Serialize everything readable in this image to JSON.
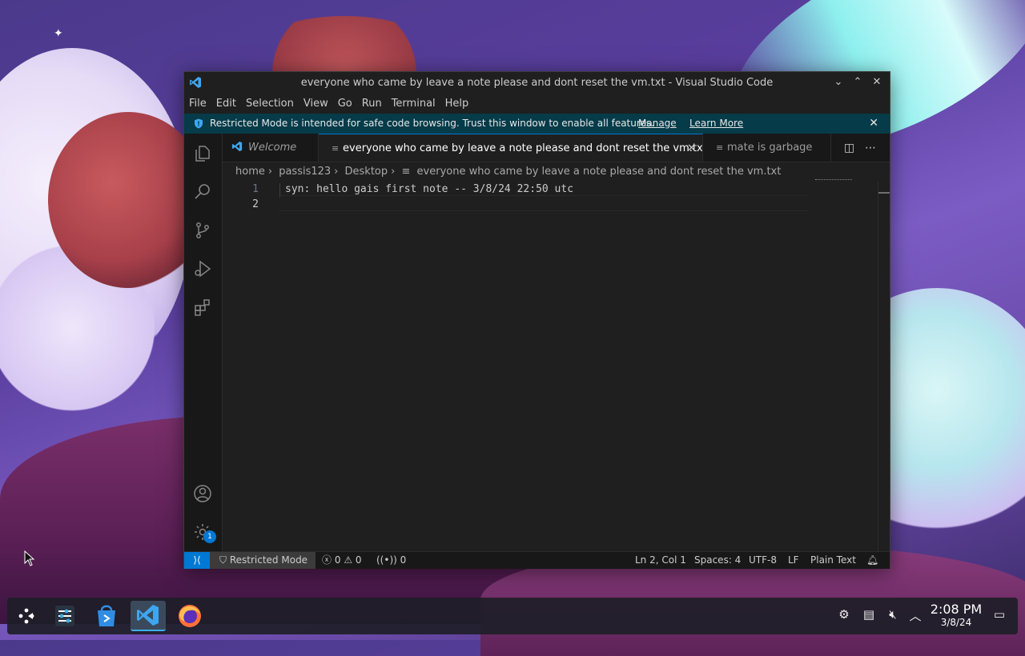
{
  "window": {
    "title": "everyone who came by leave a note please and dont reset the vm.txt - Visual Studio Code",
    "controls": [
      "minimize",
      "maximize",
      "close"
    ]
  },
  "menu": [
    "File",
    "Edit",
    "Selection",
    "View",
    "Go",
    "Run",
    "Terminal",
    "Help"
  ],
  "banner": {
    "message": "Restricted Mode is intended for safe code browsing. Trust this window to enable all features.",
    "manage": "Manage",
    "learn_more": "Learn More"
  },
  "tabs": [
    {
      "label": "Welcome",
      "active": false
    },
    {
      "label": "everyone who came by leave a note please and dont reset the vm.txt",
      "active": true
    },
    {
      "label": "mate is garbage",
      "active": false
    }
  ],
  "breadcrumb": [
    "home",
    "passis123",
    "Desktop",
    "everyone who came by leave a note please and dont reset the vm.txt"
  ],
  "editor": {
    "lines": [
      {
        "number": "1",
        "text": "syn: hello gais first note -- 3/8/24 22:50 utc"
      },
      {
        "number": "2",
        "text": ""
      }
    ]
  },
  "activity_badge": "1",
  "status": {
    "restricted": "Restricted Mode",
    "errors": "0",
    "warnings": "0",
    "ports": "0",
    "position": "Ln 2, Col 1",
    "spaces": "Spaces: 4",
    "encoding": "UTF-8",
    "eol": "LF",
    "language": "Plain Text"
  },
  "clock": {
    "time": "2:08 PM",
    "date": "3/8/24"
  },
  "colors": {
    "accent": "#0078d4",
    "banner": "#063b49",
    "editor_bg": "#1f1f1f"
  }
}
